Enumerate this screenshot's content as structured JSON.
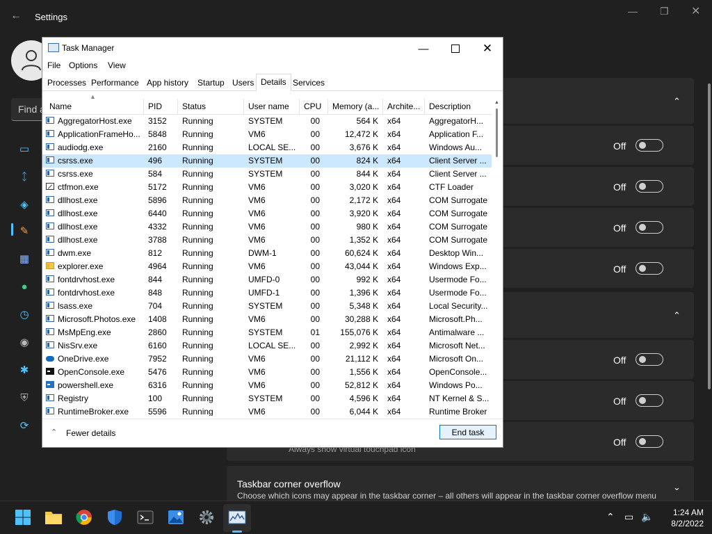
{
  "settings": {
    "window_title": "Settings",
    "search_placeholder": "Find a",
    "off_label": "Off",
    "touchpad_desc": "Always show virtual touchpad icon",
    "overflow_title": "Taskbar corner overflow",
    "overflow_desc": "Choose which icons may appear in the taskbar corner – all others will appear in the taskbar corner overflow menu"
  },
  "taskmanager": {
    "title": "Task Manager",
    "menu": [
      "File",
      "Options",
      "View"
    ],
    "tabs": [
      "Processes",
      "Performance",
      "App history",
      "Startup",
      "Users",
      "Details",
      "Services"
    ],
    "active_tab": "Details",
    "columns": [
      "Name",
      "PID",
      "Status",
      "User name",
      "CPU",
      "Memory (a...",
      "Archite...",
      "Description"
    ],
    "selected_row": 3,
    "rows": [
      [
        "AggregatorHost.exe",
        "3152",
        "Running",
        "SYSTEM",
        "00",
        "564 K",
        "x64",
        "AggregatorH..."
      ],
      [
        "ApplicationFrameHo...",
        "5848",
        "Running",
        "VM6",
        "00",
        "12,472 K",
        "x64",
        "Application F..."
      ],
      [
        "audiodg.exe",
        "2160",
        "Running",
        "LOCAL SE...",
        "00",
        "3,676 K",
        "x64",
        "Windows Au..."
      ],
      [
        "csrss.exe",
        "496",
        "Running",
        "SYSTEM",
        "00",
        "824 K",
        "x64",
        "Client Server ..."
      ],
      [
        "csrss.exe",
        "584",
        "Running",
        "SYSTEM",
        "00",
        "844 K",
        "x64",
        "Client Server ..."
      ],
      [
        "ctfmon.exe",
        "5172",
        "Running",
        "VM6",
        "00",
        "3,020 K",
        "x64",
        "CTF Loader"
      ],
      [
        "dllhost.exe",
        "5896",
        "Running",
        "VM6",
        "00",
        "2,172 K",
        "x64",
        "COM Surrogate"
      ],
      [
        "dllhost.exe",
        "6440",
        "Running",
        "VM6",
        "00",
        "3,920 K",
        "x64",
        "COM Surrogate"
      ],
      [
        "dllhost.exe",
        "4332",
        "Running",
        "VM6",
        "00",
        "980 K",
        "x64",
        "COM Surrogate"
      ],
      [
        "dllhost.exe",
        "3788",
        "Running",
        "VM6",
        "00",
        "1,352 K",
        "x64",
        "COM Surrogate"
      ],
      [
        "dwm.exe",
        "812",
        "Running",
        "DWM-1",
        "00",
        "60,624 K",
        "x64",
        "Desktop Win..."
      ],
      [
        "explorer.exe",
        "4964",
        "Running",
        "VM6",
        "00",
        "43,044 K",
        "x64",
        "Windows Exp..."
      ],
      [
        "fontdrvhost.exe",
        "844",
        "Running",
        "UMFD-0",
        "00",
        "992 K",
        "x64",
        "Usermode Fo..."
      ],
      [
        "fontdrvhost.exe",
        "848",
        "Running",
        "UMFD-1",
        "00",
        "1,396 K",
        "x64",
        "Usermode Fo..."
      ],
      [
        "lsass.exe",
        "704",
        "Running",
        "SYSTEM",
        "00",
        "5,348 K",
        "x64",
        "Local Security..."
      ],
      [
        "Microsoft.Photos.exe",
        "1408",
        "Running",
        "VM6",
        "00",
        "30,288 K",
        "x64",
        "Microsoft.Ph..."
      ],
      [
        "MsMpEng.exe",
        "2860",
        "Running",
        "SYSTEM",
        "01",
        "155,076 K",
        "x64",
        "Antimalware ..."
      ],
      [
        "NisSrv.exe",
        "6160",
        "Running",
        "LOCAL SE...",
        "00",
        "2,992 K",
        "x64",
        "Microsoft Net..."
      ],
      [
        "OneDrive.exe",
        "7952",
        "Running",
        "VM6",
        "00",
        "21,112 K",
        "x64",
        "Microsoft On..."
      ],
      [
        "OpenConsole.exe",
        "5476",
        "Running",
        "VM6",
        "00",
        "1,556 K",
        "x64",
        "OpenConsole..."
      ],
      [
        "powershell.exe",
        "6316",
        "Running",
        "VM6",
        "00",
        "52,812 K",
        "x64",
        "Windows Po..."
      ],
      [
        "Registry",
        "100",
        "Running",
        "SYSTEM",
        "00",
        "4,596 K",
        "x64",
        "NT Kernel & S..."
      ],
      [
        "RuntimeBroker.exe",
        "5596",
        "Running",
        "VM6",
        "00",
        "6,044 K",
        "x64",
        "Runtime Broker"
      ]
    ],
    "row_icons": [
      "app",
      "app",
      "app",
      "app",
      "app",
      "pen",
      "app",
      "app",
      "app",
      "app",
      "app",
      "folder",
      "app",
      "app",
      "app",
      "app",
      "app",
      "app",
      "cloud",
      "console",
      "ps",
      "app",
      "app"
    ],
    "fewer_details": "Fewer details",
    "end_task": "End task"
  },
  "taskbar": {
    "time": "1:24 AM",
    "date": "8/2/2022"
  },
  "colors": {
    "accent": "#4cc2ff",
    "selection": "#cce8ff",
    "settings_bg": "#202020"
  }
}
